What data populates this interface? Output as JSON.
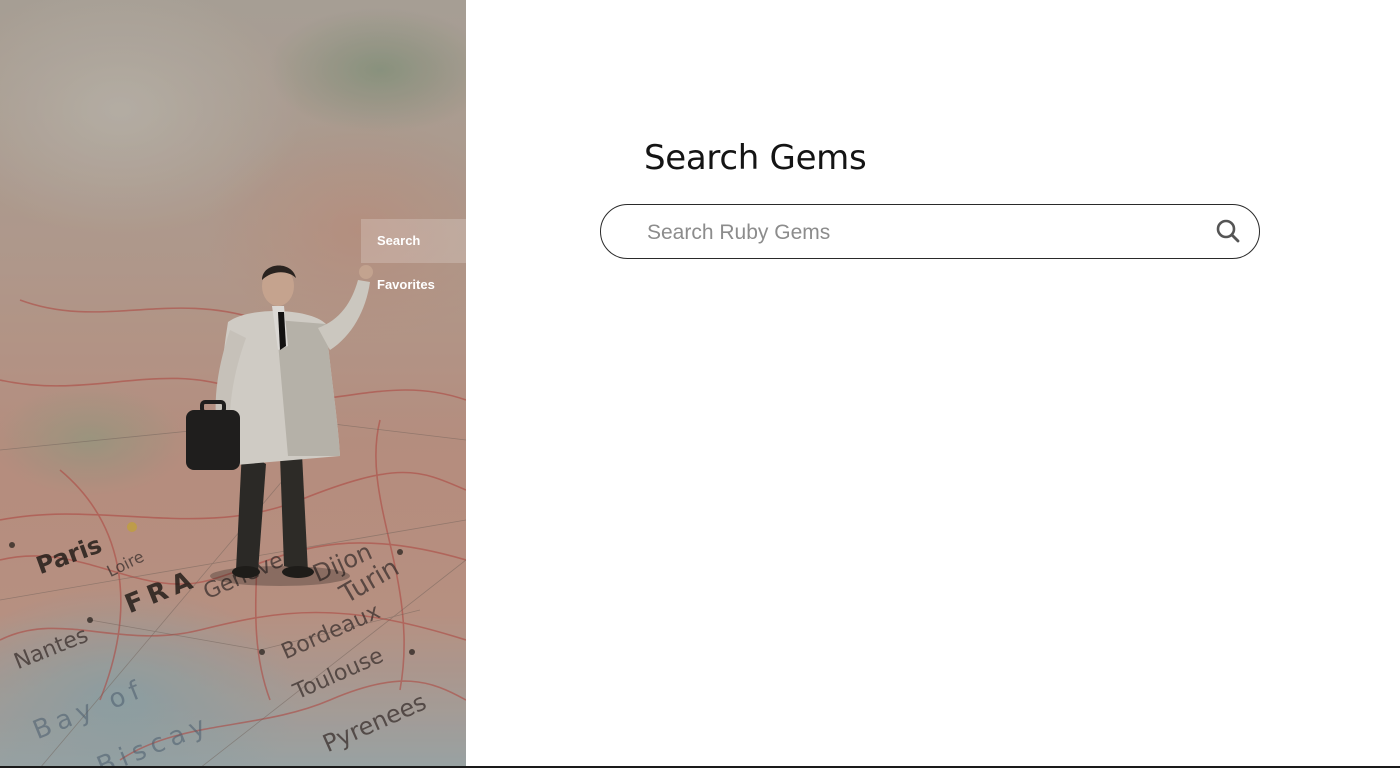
{
  "nav": {
    "items": [
      {
        "label": "Search",
        "active": true
      },
      {
        "label": "Favorites",
        "active": false
      }
    ]
  },
  "main": {
    "title": "Search Gems",
    "search": {
      "placeholder": "Search Ruby Gems",
      "value": "",
      "icon": "search-icon"
    }
  },
  "hero": {
    "map_labels": [
      "Paris",
      "FRA",
      "Geneve",
      "Dijon",
      "Turin",
      "Loire",
      "Nantes",
      "Bordeaux",
      "Toulouse",
      "Pyrenees",
      "Bay of",
      "Biscay"
    ]
  },
  "colors": {
    "accent_text": "#141414",
    "border": "#2a2a2a",
    "nav_text": "#ffffff"
  }
}
